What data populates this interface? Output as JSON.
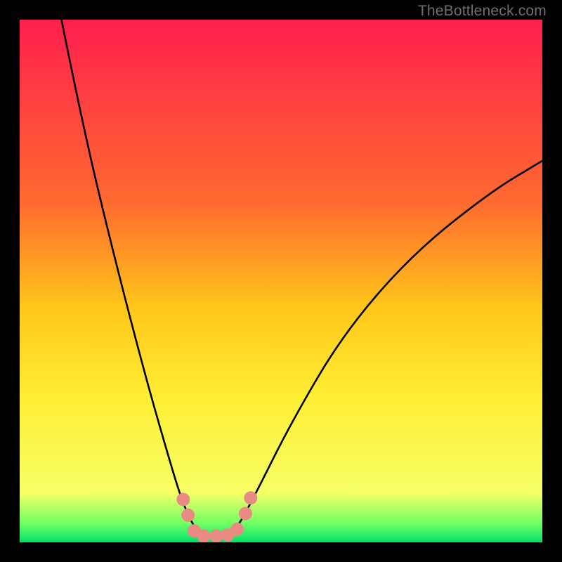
{
  "watermark": "TheBottleneck.com",
  "chart_data": {
    "type": "line",
    "title": "",
    "xlabel": "",
    "ylabel": "",
    "xlim": [
      0,
      100
    ],
    "ylim": [
      0,
      100
    ],
    "gradient_stops": [
      {
        "offset": 0,
        "color": "#ff1f4e"
      },
      {
        "offset": 0.35,
        "color": "#ff6a2f"
      },
      {
        "offset": 0.55,
        "color": "#ffc61a"
      },
      {
        "offset": 0.72,
        "color": "#ffee33"
      },
      {
        "offset": 0.905,
        "color": "#f7ff66"
      },
      {
        "offset": 0.965,
        "color": "#6cff64"
      },
      {
        "offset": 1.0,
        "color": "#00e06a"
      }
    ],
    "series": [
      {
        "name": "bottleneck-curve",
        "color": "#000000",
        "points": [
          {
            "x": 8,
            "y": 100
          },
          {
            "x": 12,
            "y": 80
          },
          {
            "x": 18,
            "y": 55
          },
          {
            "x": 24,
            "y": 32
          },
          {
            "x": 28,
            "y": 18
          },
          {
            "x": 31,
            "y": 8
          },
          {
            "x": 33.5,
            "y": 2.5
          },
          {
            "x": 36,
            "y": 1
          },
          {
            "x": 39,
            "y": 1
          },
          {
            "x": 41.5,
            "y": 2.5
          },
          {
            "x": 45,
            "y": 9
          },
          {
            "x": 52,
            "y": 23
          },
          {
            "x": 62,
            "y": 40
          },
          {
            "x": 75,
            "y": 55
          },
          {
            "x": 90,
            "y": 67
          },
          {
            "x": 100,
            "y": 73
          }
        ]
      },
      {
        "name": "highlight-dots",
        "color": "#e98b83",
        "points": [
          {
            "x": 31.3,
            "y": 8.2
          },
          {
            "x": 32.2,
            "y": 5.2
          },
          {
            "x": 33.4,
            "y": 2.2
          },
          {
            "x": 35.2,
            "y": 1.2
          },
          {
            "x": 37.6,
            "y": 1.2
          },
          {
            "x": 39.8,
            "y": 1.4
          },
          {
            "x": 41.6,
            "y": 2.5
          },
          {
            "x": 43.2,
            "y": 5.5
          },
          {
            "x": 44.2,
            "y": 8.5
          }
        ]
      }
    ]
  }
}
